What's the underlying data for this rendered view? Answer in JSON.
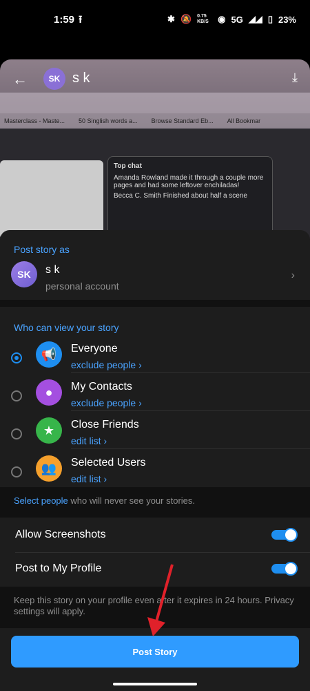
{
  "status_bar": {
    "time": "1:59",
    "network": "5G",
    "speed": "0.75 KB/S",
    "battery": "23%"
  },
  "preview": {
    "avatar_initials": "SK",
    "name": "s k",
    "bookmarks": [
      "Masterclass - Maste...",
      "50 Singlish words a...",
      "Browse Standard Eb...",
      "All Bookmar"
    ],
    "top_chat": "Top chat",
    "chat_lines": [
      "Amanda Rowland made it through a couple more pages and had some leftover enchiladas!",
      "Becca C. Smith Finished about half a scene"
    ]
  },
  "post_as": {
    "title": "Post story as",
    "avatar_initials": "SK",
    "name": "s k",
    "subtitle": "personal account"
  },
  "audience": {
    "title": "Who can view your story",
    "options": [
      {
        "label": "Everyone",
        "link": "exclude people ›",
        "selected": true,
        "color": "#1e8ef0",
        "icon": "megaphone-icon"
      },
      {
        "label": "My Contacts",
        "link": "exclude people ›",
        "selected": false,
        "color": "#a44fe0",
        "icon": "person-icon"
      },
      {
        "label": "Close Friends",
        "link": "edit list ›",
        "selected": false,
        "color": "#37b54a",
        "icon": "star-icon"
      },
      {
        "label": "Selected Users",
        "link": "edit list ›",
        "selected": false,
        "color": "#f5a02c",
        "icon": "group-icon"
      }
    ]
  },
  "note": {
    "link": "Select people",
    "text": " who will never see your stories."
  },
  "toggles": [
    {
      "label": "Allow Screenshots",
      "on": true
    },
    {
      "label": "Post to My Profile",
      "on": true
    }
  ],
  "profile_note": "Keep this story on your profile even after it expires in 24 hours. Privacy settings will apply.",
  "post_button": "Post Story"
}
